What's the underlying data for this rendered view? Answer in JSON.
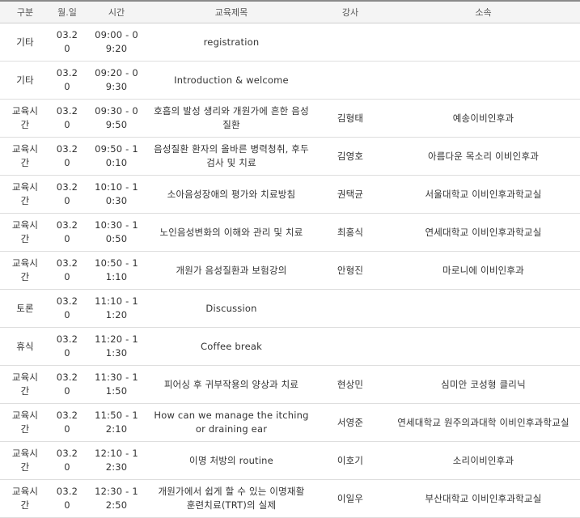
{
  "headers": [
    "구분",
    "월.일",
    "시간",
    "교육제목",
    "강사",
    "소속"
  ],
  "rows": [
    {
      "category": "기타",
      "date": "03.20",
      "time": "09:00 - 09:20",
      "title": "registration",
      "speaker": "",
      "affiliation": ""
    },
    {
      "category": "기타",
      "date": "03.20",
      "time": "09:20 - 09:30",
      "title": "Introduction & welcome",
      "speaker": "",
      "affiliation": ""
    },
    {
      "category": "교육시간",
      "date": "03.20",
      "time": "09:30 - 09:50",
      "title": "호흡의 발성 생리와 개원가에 흔한 음성질환",
      "speaker": "김형태",
      "affiliation": "예송이비인후과"
    },
    {
      "category": "교육시간",
      "date": "03.20",
      "time": "09:50 - 10:10",
      "title": "음성질환 환자의 올바른 병력청취, 후두검사 및 치료",
      "speaker": "김영호",
      "affiliation": "아름다운 목소리 이비인후과"
    },
    {
      "category": "교육시간",
      "date": "03.20",
      "time": "10:10 - 10:30",
      "title": "소아음성장애의 평가와 치료방침",
      "speaker": "권택균",
      "affiliation": "서울대학교 이비인후과학교실"
    },
    {
      "category": "교육시간",
      "date": "03.20",
      "time": "10:30 - 10:50",
      "title": "노인음성변화의 이해와 관리 및 치료",
      "speaker": "최홍식",
      "affiliation": "연세대학교 이비인후과학교실"
    },
    {
      "category": "교육시간",
      "date": "03.20",
      "time": "10:50 - 11:10",
      "title": "개원가 음성질환과 보험강의",
      "speaker": "안형진",
      "affiliation": "마로니에 이비인후과"
    },
    {
      "category": "토론",
      "date": "03.20",
      "time": "11:10 - 11:20",
      "title": "Discussion",
      "speaker": "",
      "affiliation": ""
    },
    {
      "category": "휴식",
      "date": "03.20",
      "time": "11:20 - 11:30",
      "title": "Coffee break",
      "speaker": "",
      "affiliation": ""
    },
    {
      "category": "교육시간",
      "date": "03.20",
      "time": "11:30 - 11:50",
      "title": "피어싱 후 귀부작용의 양상과 치료",
      "speaker": "현상민",
      "affiliation": "심미안 코성형 클리닉"
    },
    {
      "category": "교육시간",
      "date": "03.20",
      "time": "11:50 - 12:10",
      "title": "How can we manage the itching or draining ear",
      "speaker": "서영준",
      "affiliation": "연세대학교 원주의과대학 이비인후과학교실"
    },
    {
      "category": "교육시간",
      "date": "03.20",
      "time": "12:10 - 12:30",
      "title": "이명 처방의 routine",
      "speaker": "이호기",
      "affiliation": "소리이비인후과"
    },
    {
      "category": "교육시간",
      "date": "03.20",
      "time": "12:30 - 12:50",
      "title": "개원가에서 쉽게 할 수 있는 이명재활 훈련치료(TRT)의 실제",
      "speaker": "이일우",
      "affiliation": "부산대학교 이비인후과학교실"
    }
  ]
}
